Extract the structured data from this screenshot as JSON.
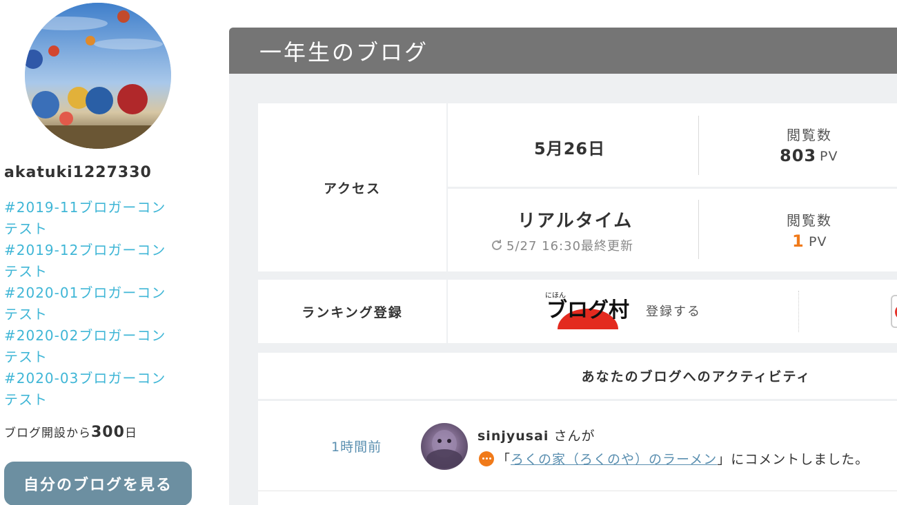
{
  "sidebar": {
    "username": "akatuki1227330",
    "tags": [
      "#2019-11ブロガーコン",
      "テスト",
      "#2019-12ブロガーコン",
      "テスト",
      "#2020-01ブロガーコン",
      "テスト",
      "#2020-02ブロガーコン",
      "テスト",
      "#2020-03ブロガーコン",
      "テスト"
    ],
    "open_days_prefix": "ブログ開設から",
    "open_days_value": "300",
    "open_days_suffix": "日",
    "view_blog_button": "自分のブログを見る"
  },
  "panel": {
    "title": "一年生のブログ"
  },
  "access": {
    "label": "アクセス",
    "daily": {
      "date": "5月26日",
      "pv_label": "閲覧数",
      "pv_value": "803",
      "pv_unit": "PV"
    },
    "realtime": {
      "title": "リアルタイム",
      "updated": "5/27 16:30最終更新",
      "pv_label": "閲覧数",
      "pv_value": "1",
      "pv_unit": "PV"
    }
  },
  "ranking": {
    "label": "ランキング登録",
    "logo_small_text": "にほん",
    "logo_text": "ブログ村",
    "register_label": "登録する"
  },
  "activity": {
    "title": "あなたのブログへのアクティビティ",
    "items": [
      {
        "time": "1時間前",
        "user": "sinjyusai",
        "user_suffix": "さんが",
        "quote_open": "「",
        "post_title": "ろくの家（ろくのや）のラーメン",
        "quote_close": "」",
        "action": "にコメントしました。"
      }
    ]
  },
  "colors": {
    "tag_link": "#3fb6d6",
    "header_bg": "#757575",
    "button_bg": "#6c8fa1",
    "accent_orange": "#f07a1a",
    "link_blue": "#5a8fb0"
  },
  "icons": {
    "refresh": "refresh-icon",
    "comment": "comment-icon"
  }
}
